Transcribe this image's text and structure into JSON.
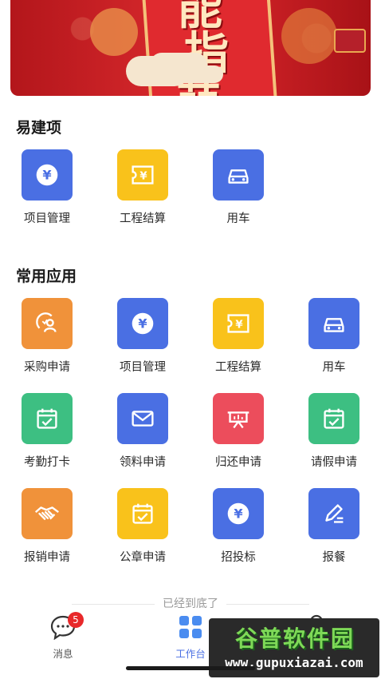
{
  "banner": {
    "chars": [
      "能",
      "指",
      "萌"
    ]
  },
  "sections": {
    "yijianxiang": {
      "title": "易建项",
      "items": [
        {
          "label": "项目管理",
          "icon": "yuan-coin-icon",
          "color": "#4a6fe3"
        },
        {
          "label": "工程结算",
          "icon": "ticket-yuan-icon",
          "color": "#f9c21b"
        },
        {
          "label": "用车",
          "icon": "car-icon",
          "color": "#4a6fe3"
        }
      ]
    },
    "common": {
      "title": "常用应用",
      "items": [
        {
          "label": "采购申请",
          "icon": "purchase-person-icon",
          "color": "#f0923a"
        },
        {
          "label": "项目管理",
          "icon": "yuan-coin-icon",
          "color": "#4a6fe3"
        },
        {
          "label": "工程结算",
          "icon": "ticket-yuan-icon",
          "color": "#f9c21b"
        },
        {
          "label": "用车",
          "icon": "car-icon",
          "color": "#4a6fe3"
        },
        {
          "label": "考勤打卡",
          "icon": "calendar-check-icon",
          "color": "#3dbf82"
        },
        {
          "label": "领料申请",
          "icon": "envelope-icon",
          "color": "#4a6fe3"
        },
        {
          "label": "归还申请",
          "icon": "presentation-chart-icon",
          "color": "#ec4d5c"
        },
        {
          "label": "请假申请",
          "icon": "calendar-check-icon",
          "color": "#3dbf82"
        },
        {
          "label": "报销申请",
          "icon": "handshake-icon",
          "color": "#f0923a"
        },
        {
          "label": "公章申请",
          "icon": "calendar-check-icon",
          "color": "#f9c21b"
        },
        {
          "label": "招投标",
          "icon": "yuan-coin-icon",
          "color": "#4a6fe3"
        },
        {
          "label": "报餐",
          "icon": "pen-note-icon",
          "color": "#4a6fe3"
        }
      ]
    }
  },
  "footer": {
    "end_text": "已经到底了"
  },
  "tabbar": {
    "tabs": [
      {
        "label": "消息",
        "icon": "chat-bubble-icon",
        "badge": "5"
      },
      {
        "label": "工作台",
        "icon": "grid-icon",
        "active": true
      },
      {
        "label": "",
        "icon": "search-icon"
      }
    ]
  },
  "watermark": {
    "title": "谷普软件园",
    "url": "www.gupuxiazai.com"
  }
}
